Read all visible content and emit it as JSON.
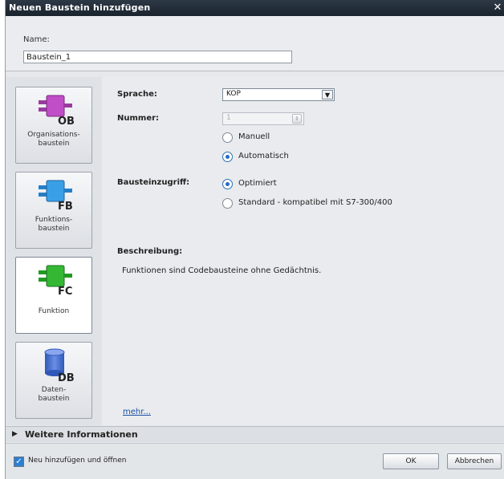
{
  "dialog": {
    "title": "Neuen Baustein hinzufügen",
    "close_icon": "close-icon"
  },
  "name": {
    "label": "Name:",
    "value": "Baustein_1"
  },
  "block_types": [
    {
      "id": "OB",
      "label": "Organisations-\nbaustein",
      "color": "#b03fb2"
    },
    {
      "id": "FB",
      "label": "Funktions-\nbaustein",
      "color": "#2f8fd8"
    },
    {
      "id": "FC",
      "label": "Funktion",
      "color": "#2aa32a"
    },
    {
      "id": "DB",
      "label": "Daten-\nbaustein",
      "color": "#3a66c8"
    }
  ],
  "language": {
    "label": "Sprache:",
    "value": "KOP"
  },
  "number": {
    "label": "Nummer:",
    "value": "1",
    "options": [
      {
        "label": "Manuell",
        "checked": false
      },
      {
        "label": "Automatisch",
        "checked": true
      }
    ]
  },
  "access": {
    "label": "Bausteinzugriff:",
    "options": [
      {
        "label": "Optimiert",
        "checked": true
      },
      {
        "label": "Standard - kompatibel mit S7-300/400",
        "checked": false
      }
    ]
  },
  "description": {
    "label": "Beschreibung:",
    "text": "Funktionen sind Codebausteine ohne Gedächtnis.",
    "more_link": "mehr..."
  },
  "more_info": {
    "label": "Weitere Informationen"
  },
  "footer": {
    "checkbox_label": "Neu hinzufügen und öffnen",
    "ok_label": "OK",
    "cancel_label": "Abbrechen"
  }
}
